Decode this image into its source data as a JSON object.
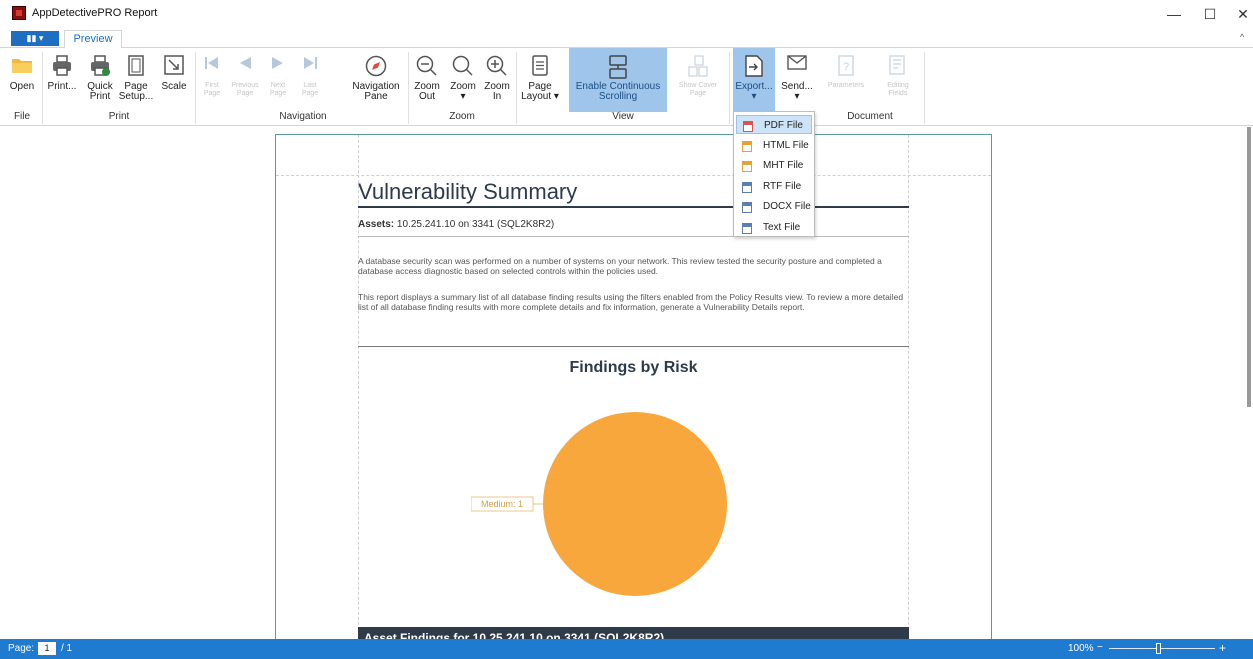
{
  "window": {
    "title": "AppDetectivePRO Report",
    "minimize_glyph": "—",
    "maximize_glyph": "☐",
    "close_glyph": "✕"
  },
  "tabs": {
    "app_menu": "▮▮ ▾",
    "preview": "Preview",
    "collapse_glyph": "^"
  },
  "ribbon": {
    "open": "Open",
    "print": "Print...",
    "quick_print": "Quick\nPrint",
    "page_setup": "Page\nSetup...",
    "scale": "Scale",
    "first_page": "First\nPage",
    "previous_page": "Previous\nPage",
    "next_page": "Next\nPage",
    "last_page": "Last\nPage",
    "navigation_pane": "Navigation\nPane",
    "zoom_out": "Zoom\nOut",
    "zoom": "Zoom\n▾",
    "zoom_in": "Zoom\nIn",
    "page_layout": "Page\nLayout ▾",
    "continuous_scrolling": "Enable Continuous\nScrolling",
    "show_cover_page": "Show Cover\nPage",
    "export": "Export...\n▾",
    "send": "Send...\n▾",
    "parameters": "Parameters",
    "editing_fields": "Editing\nFields",
    "groups": {
      "file": "File",
      "print": "Print",
      "navigation": "Navigation",
      "zoom": "Zoom",
      "view": "View",
      "document": "Document"
    }
  },
  "export_menu": {
    "items": [
      {
        "label": "PDF File",
        "color": "#d9534f"
      },
      {
        "label": "HTML File",
        "color": "#e8a030"
      },
      {
        "label": "MHT File",
        "color": "#e8a030"
      },
      {
        "label": "RTF File",
        "color": "#5b7fb5"
      },
      {
        "label": "DOCX File",
        "color": "#5b7fb5"
      },
      {
        "label": "Text File",
        "color": "#5b7fb5"
      }
    ],
    "highlighted_index": 0
  },
  "report": {
    "title": "Vulnerability Summary",
    "assets_label": "Assets:",
    "assets_value": "10.25.241.10 on 3341 (SQL2K8R2)",
    "paragraph1": "A database security scan was performed on a number of systems on your network. This review tested the security posture and completed a database access diagnostic based on selected controls within the policies used.",
    "paragraph2": "This report displays a summary list of all database finding results using the filters enabled from the Policy Results view. To review a more detailed list of all database finding results with more complete details and fix information, generate a Vulnerability Details report.",
    "section_header": "Asset Findings for 10.25.241.10 on 3341 (SQL2K8R2)"
  },
  "chart_data": {
    "type": "pie",
    "title": "Findings by Risk",
    "slices": [
      {
        "label": "Medium: 1",
        "value": 1,
        "color": "#f8a73c"
      }
    ]
  },
  "status": {
    "page_label": "Page:",
    "page_current": "1",
    "page_total": "/ 1",
    "zoom_level": "100%",
    "zoom_fraction": 0.47,
    "zoom_minus": "−",
    "zoom_plus": "+"
  },
  "colors": {
    "accent": "#1e7bd0",
    "report_dark": "#2f3b48",
    "active_button": "#9fc5ea"
  }
}
